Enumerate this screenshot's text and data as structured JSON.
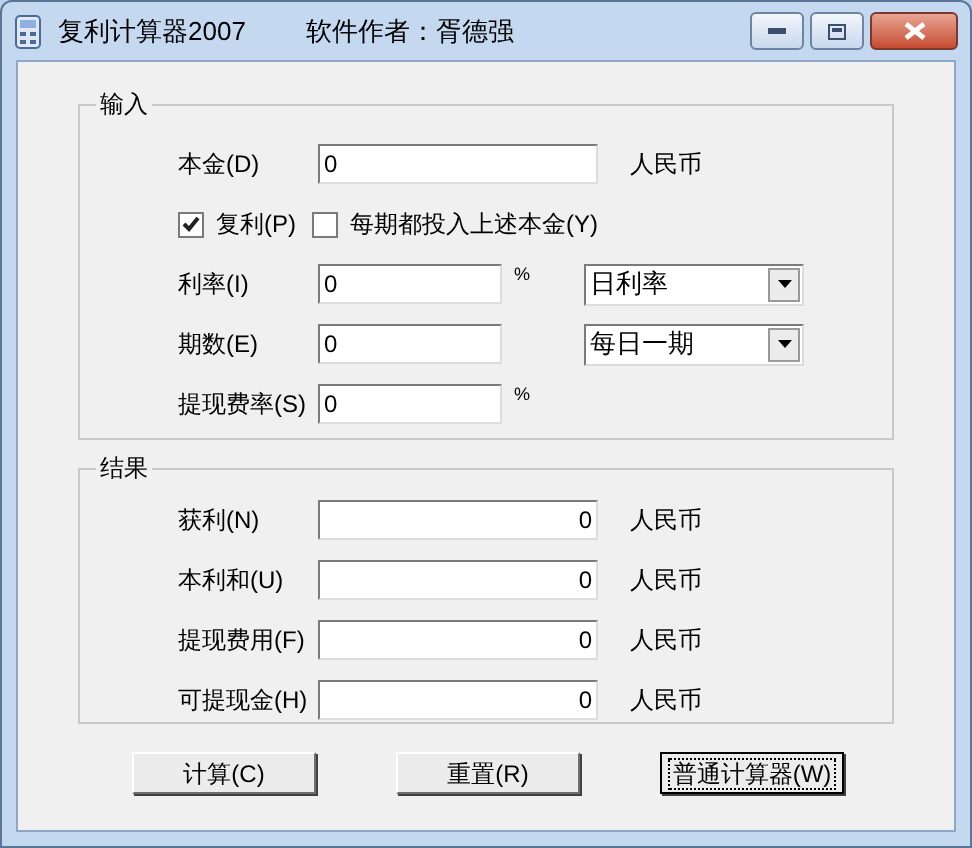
{
  "window": {
    "title": "复利计算器2007",
    "author": "软件作者：胥德强"
  },
  "input_group": {
    "title": "输入",
    "rows": [
      {
        "kind": "field",
        "label": "本金(D)",
        "value": "0",
        "unit": "人民币",
        "wide": true
      },
      {
        "kind": "checks",
        "checks": [
          {
            "label": "复利(P)",
            "checked": true
          },
          {
            "label": "每期都投入上述本金(Y)",
            "checked": false
          }
        ]
      },
      {
        "kind": "field",
        "label": "利率(I)",
        "value": "0",
        "unit": "%",
        "select": "日利率"
      },
      {
        "kind": "field",
        "label": "期数(E)",
        "value": "0",
        "select": "每日一期"
      },
      {
        "kind": "field",
        "label": "提现费率(S)",
        "value": "0",
        "unit": "%"
      }
    ]
  },
  "result_group": {
    "title": "结果",
    "rows": [
      {
        "label": "获利(N)",
        "value": "0",
        "unit": "人民币"
      },
      {
        "label": "本利和(U)",
        "value": "0",
        "unit": "人民币"
      },
      {
        "label": "提现费用(F)",
        "value": "0",
        "unit": "人民币"
      },
      {
        "label": "可提现金(H)",
        "value": "0",
        "unit": "人民币"
      }
    ]
  },
  "buttons": [
    {
      "label": "计算(C)",
      "focused": false
    },
    {
      "label": "重置(R)",
      "focused": false
    },
    {
      "label": "普通计算器(W)",
      "focused": true
    }
  ]
}
